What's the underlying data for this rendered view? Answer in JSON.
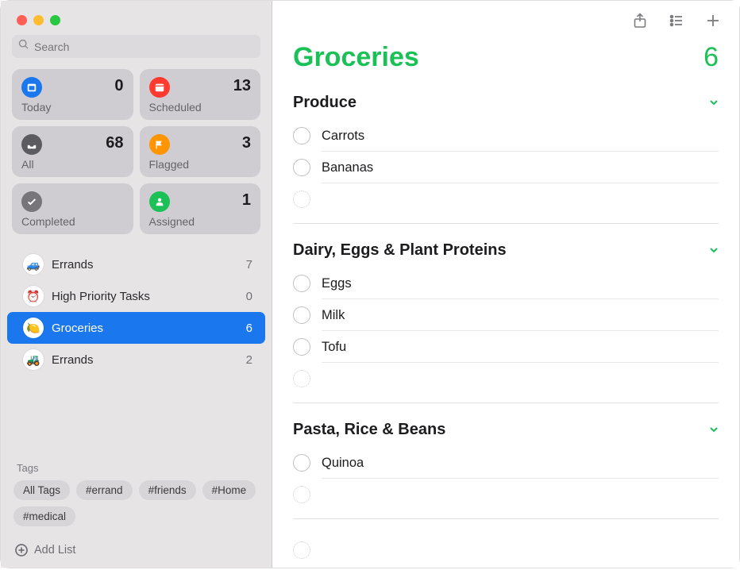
{
  "search": {
    "placeholder": "Search"
  },
  "smartLists": {
    "today": {
      "label": "Today",
      "count": 0,
      "color": "#1a77ed"
    },
    "scheduled": {
      "label": "Scheduled",
      "count": 13,
      "color": "#ff3b30"
    },
    "all": {
      "label": "All",
      "count": 68,
      "color": "#5b5b60"
    },
    "flagged": {
      "label": "Flagged",
      "count": 3,
      "color": "#ff9500"
    },
    "completed": {
      "label": "Completed",
      "count": "",
      "color": "#777579"
    },
    "assigned": {
      "label": "Assigned",
      "count": 1,
      "color": "#1bc157"
    }
  },
  "userLists": [
    {
      "name": "Errands",
      "count": 7,
      "emoji": "🚙"
    },
    {
      "name": "High Priority Tasks",
      "count": 0,
      "emoji": "⏰"
    },
    {
      "name": "Groceries",
      "count": 6,
      "emoji": "🍋",
      "selected": true
    },
    {
      "name": "Errands",
      "count": 2,
      "emoji": "🚜"
    }
  ],
  "tagsHeader": "Tags",
  "tags": [
    "All Tags",
    "#errand",
    "#friends",
    "#Home",
    "#medical"
  ],
  "addList": "Add List",
  "main": {
    "title": "Groceries",
    "count": 6,
    "sections": [
      {
        "title": "Produce",
        "items": [
          "Carrots",
          "Bananas"
        ]
      },
      {
        "title": "Dairy, Eggs & Plant Proteins",
        "items": [
          "Eggs",
          "Milk",
          "Tofu"
        ]
      },
      {
        "title": "Pasta, Rice & Beans",
        "items": [
          "Quinoa"
        ]
      }
    ]
  }
}
